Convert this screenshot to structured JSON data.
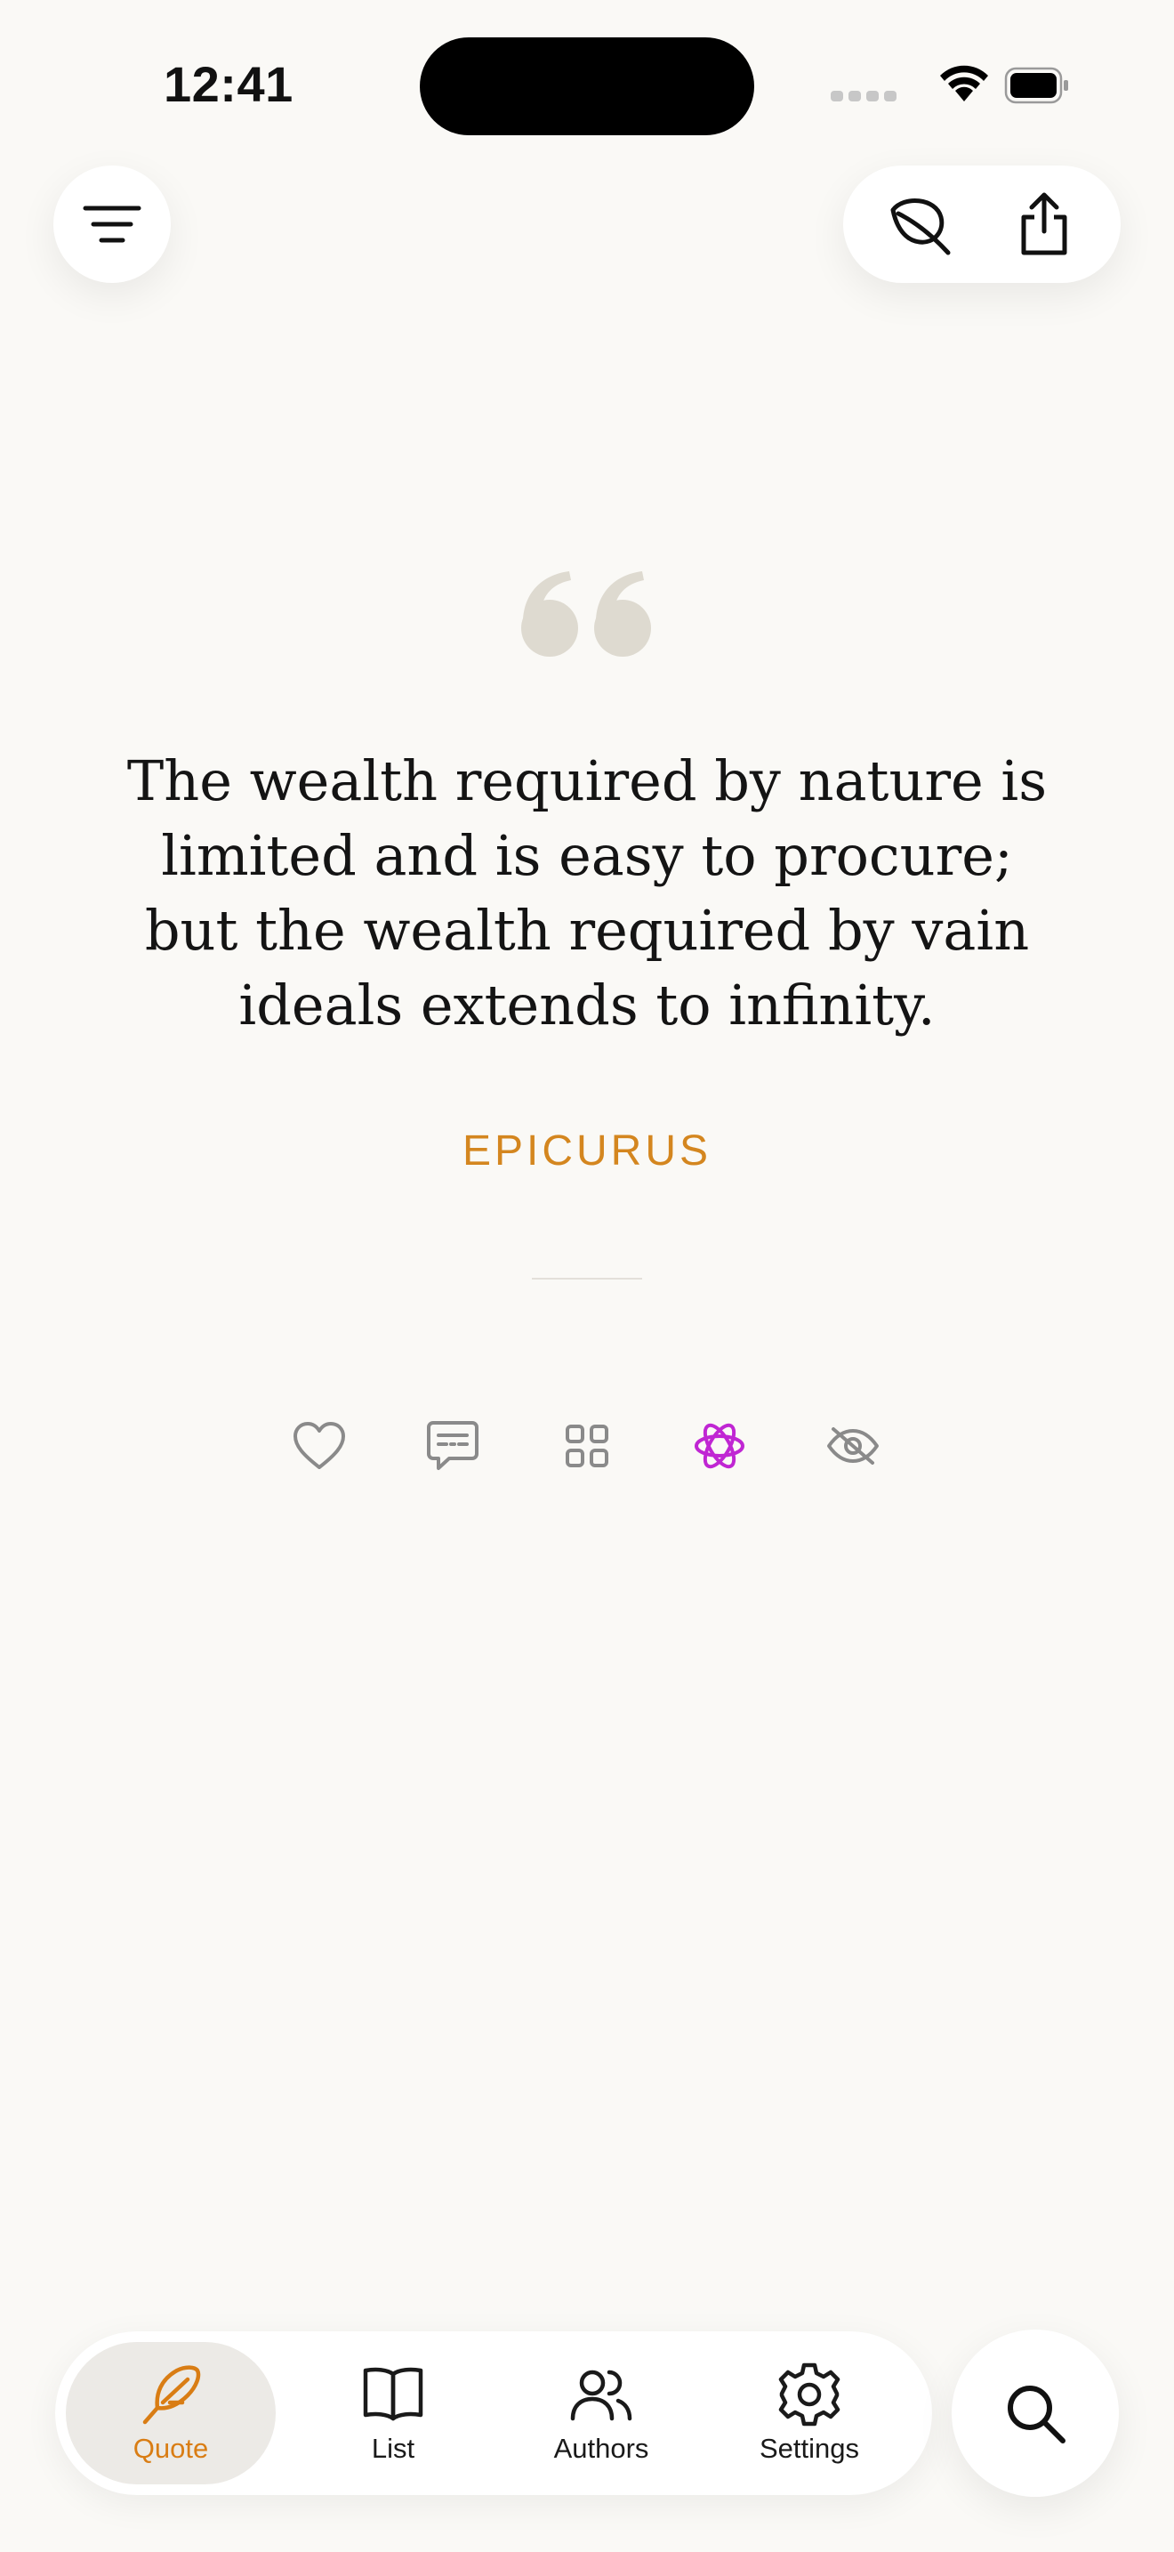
{
  "status_bar": {
    "time": "12:41"
  },
  "quote": {
    "text": "The wealth required by nature is limited and is easy to procure; but the wealth required by vain ideals extends to infinity.",
    "author": "EPICURUS"
  },
  "actions": [
    {
      "name": "favorite",
      "icon": "heart-icon"
    },
    {
      "name": "comment",
      "icon": "message-icon"
    },
    {
      "name": "collections",
      "icon": "grid-icon"
    },
    {
      "name": "spirituality",
      "icon": "atom-icon",
      "color": "#c026d3"
    },
    {
      "name": "hide",
      "icon": "eye-off-icon"
    }
  ],
  "tabs": [
    {
      "label": "Quote",
      "icon": "feather-icon",
      "active": true
    },
    {
      "label": "List",
      "icon": "book-icon",
      "active": false
    },
    {
      "label": "Authors",
      "icon": "users-icon",
      "active": false
    },
    {
      "label": "Settings",
      "icon": "gear-icon",
      "active": false
    }
  ],
  "colors": {
    "background": "#faf9f6",
    "accent": "#d97d14",
    "author": "#d4861f",
    "quote_mark": "#dedad0",
    "active_tab_bg": "#eceae6",
    "atom": "#c026d3",
    "icon_gray": "#8a8a8a"
  }
}
